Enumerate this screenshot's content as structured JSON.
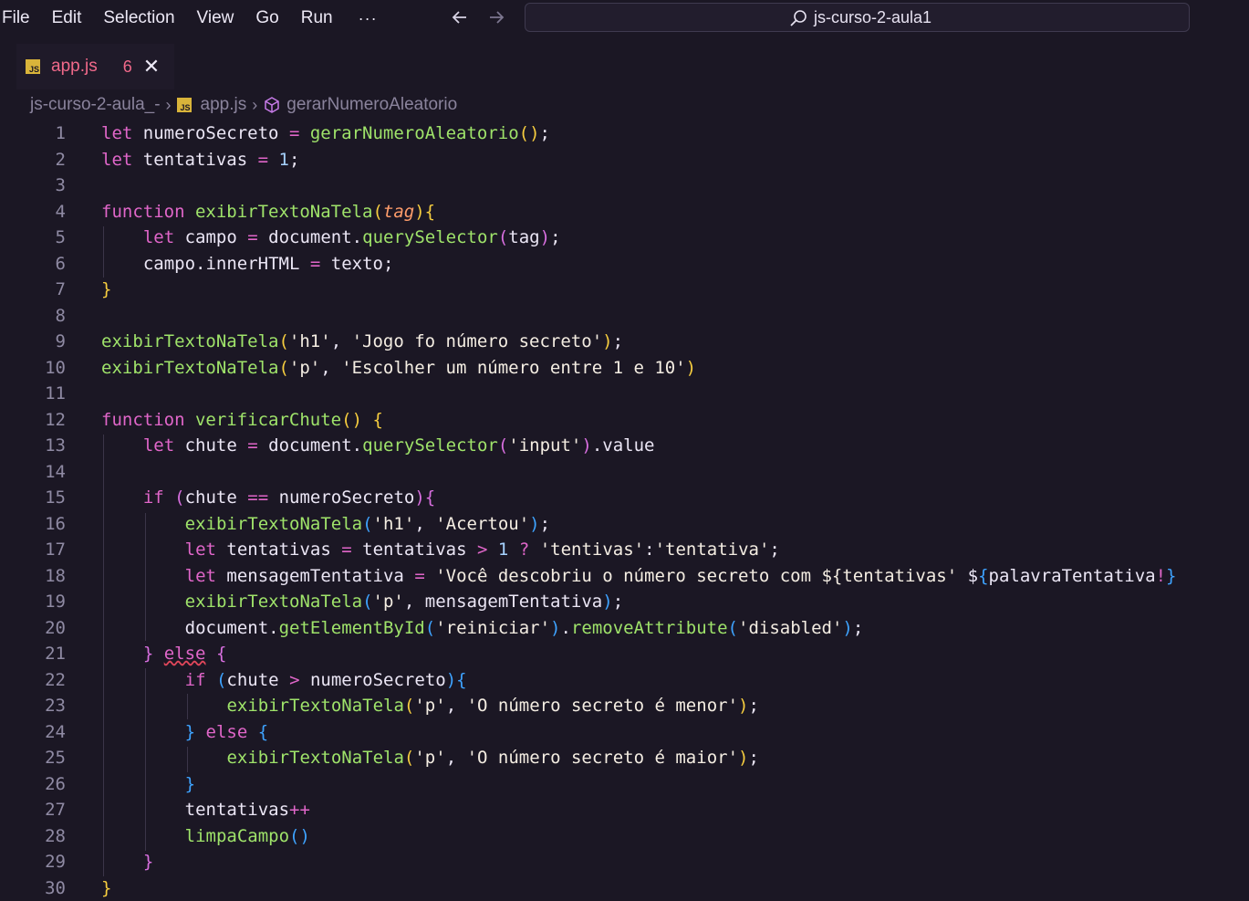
{
  "menu": {
    "items": [
      "File",
      "Edit",
      "Selection",
      "View",
      "Go",
      "Run"
    ],
    "more": "···"
  },
  "nav": {
    "back_icon": "arrow-left-icon",
    "forward_icon": "arrow-right-icon"
  },
  "search": {
    "text": "js-curso-2-aula1",
    "icon": "search-icon"
  },
  "tab": {
    "badge": "JS",
    "name": "app.js",
    "problems": "6",
    "close": "✕"
  },
  "breadcrumb": {
    "folder": "js-curso-2-aula_-",
    "file": "app.js",
    "symbol": "gerarNumeroAleatorio"
  },
  "colors": {
    "background": "#1b1724",
    "keyword": "#e066c9",
    "function": "#9fe36a",
    "error": "#f0698a",
    "js_badge": "#d9b43a"
  },
  "code": {
    "line_numbers": [
      "1",
      "2",
      "3",
      "4",
      "5",
      "6",
      "7",
      "8",
      "9",
      "10",
      "11",
      "12",
      "13",
      "14",
      "15",
      "16",
      "17",
      "18",
      "19",
      "20",
      "21",
      "22",
      "23",
      "24",
      "25",
      "26",
      "27",
      "28",
      "29",
      "30"
    ],
    "lines": [
      "let numeroSecreto = gerarNumeroAleatorio();",
      "let tentativas = 1;",
      "",
      "function exibirTextoNaTela(tag){",
      "    let campo = document.querySelector(tag);",
      "    campo.innerHTML = texto;",
      "}",
      "",
      "exibirTextoNaTela('h1', 'Jogo fo número secreto');",
      "exibirTextoNaTela('p', 'Escolher um número entre 1 e 10')",
      "",
      "function verificarChute() {",
      "    let chute = document.querySelector('input').value",
      "",
      "    if (chute == numeroSecreto){",
      "        exibirTextoNaTela('h1', 'Acertou');",
      "        let tentativas = tentativas > 1 ? 'tentivas':'tentativa';",
      "        let mensagemTentativa = 'Você descobriu o número secreto com ${tentativas' ${palavraTentativa!}",
      "        exibirTextoNaTela('p', mensagemTentativa);",
      "        document.getElementById('reiniciar').removeAttribute('disabled');",
      "    } else {",
      "        if (chute > numeroSecreto){",
      "            exibirTextoNaTela('p', 'O número secreto é menor');",
      "        } else {",
      "            exibirTextoNaTela('p', 'O número secreto é maior');",
      "        }",
      "        tentativas++",
      "        limpaCampo()",
      "    }",
      "}"
    ]
  }
}
